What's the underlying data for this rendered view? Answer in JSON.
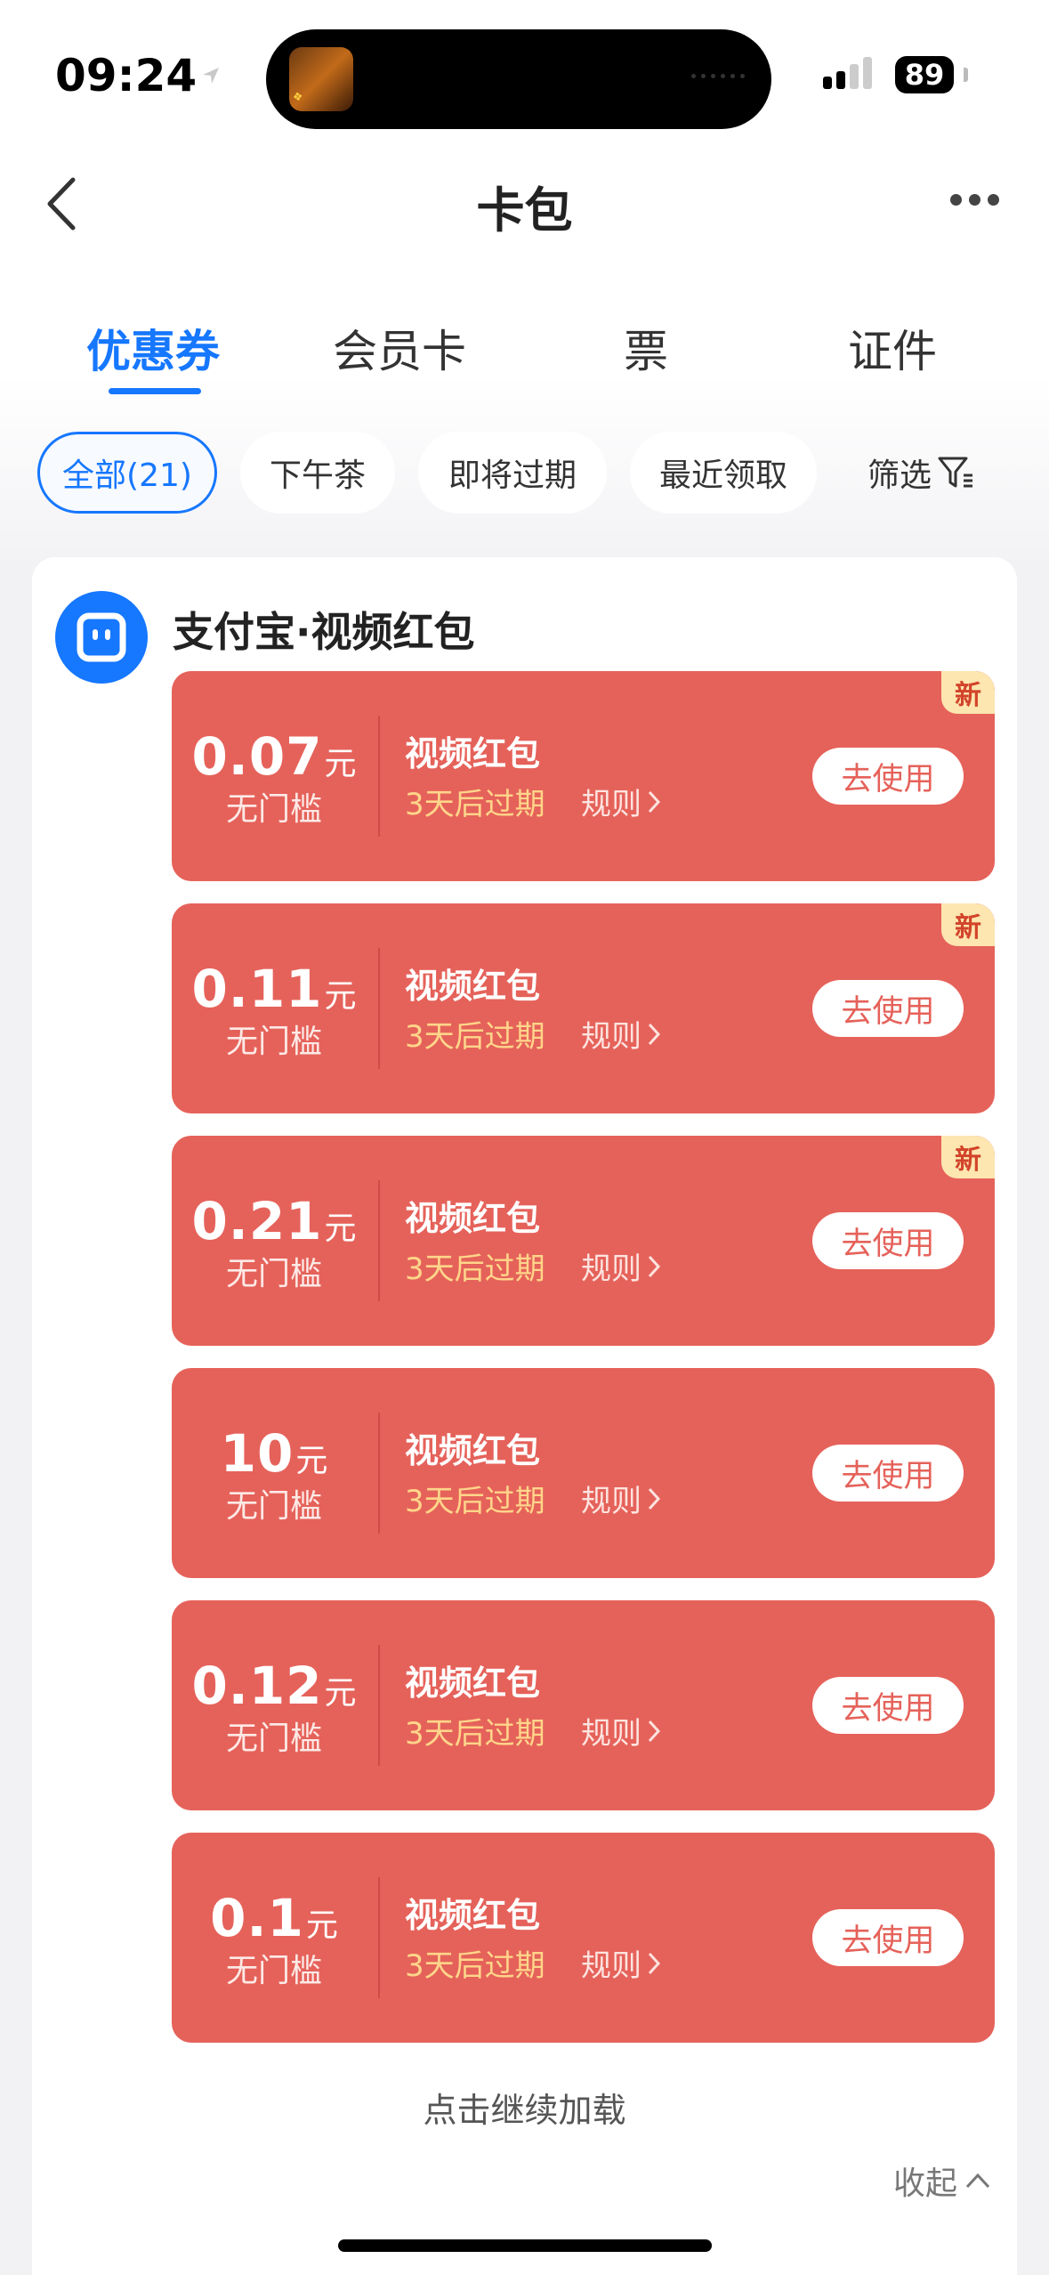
{
  "status_bar": {
    "time": "09:24",
    "battery": "89"
  },
  "nav": {
    "title": "卡包"
  },
  "tabs": [
    {
      "label": "优惠券",
      "active": true
    },
    {
      "label": "会员卡",
      "active": false
    },
    {
      "label": "票",
      "active": false
    },
    {
      "label": "证件",
      "active": false
    }
  ],
  "chips": [
    {
      "label": "全部(21)",
      "active": true
    },
    {
      "label": "下午茶",
      "active": false
    },
    {
      "label": "即将过期",
      "active": false
    },
    {
      "label": "最近领取",
      "active": false
    }
  ],
  "filter_label": "筛选",
  "merchant": {
    "name": "支付宝·视频红包"
  },
  "coupons": [
    {
      "amount": "0.07",
      "unit": "元",
      "threshold": "无门槛",
      "title": "视频红包",
      "expire": "3天后过期",
      "rules": "规则",
      "button": "去使用",
      "new_tag": "新"
    },
    {
      "amount": "0.11",
      "unit": "元",
      "threshold": "无门槛",
      "title": "视频红包",
      "expire": "3天后过期",
      "rules": "规则",
      "button": "去使用",
      "new_tag": "新"
    },
    {
      "amount": "0.21",
      "unit": "元",
      "threshold": "无门槛",
      "title": "视频红包",
      "expire": "3天后过期",
      "rules": "规则",
      "button": "去使用",
      "new_tag": "新"
    },
    {
      "amount": "10",
      "unit": "元",
      "threshold": "无门槛",
      "title": "视频红包",
      "expire": "3天后过期",
      "rules": "规则",
      "button": "去使用",
      "new_tag": ""
    },
    {
      "amount": "0.12",
      "unit": "元",
      "threshold": "无门槛",
      "title": "视频红包",
      "expire": "3天后过期",
      "rules": "规则",
      "button": "去使用",
      "new_tag": ""
    },
    {
      "amount": "0.1",
      "unit": "元",
      "threshold": "无门槛",
      "title": "视频红包",
      "expire": "3天后过期",
      "rules": "规则",
      "button": "去使用",
      "new_tag": ""
    }
  ],
  "load_more": "点击继续加载",
  "collapse": "收起",
  "colors": {
    "accent": "#1677ff",
    "coupon_bg": "#e5625a",
    "expire_text": "#ffd58a",
    "new_tag_bg": "#fde6b0"
  }
}
